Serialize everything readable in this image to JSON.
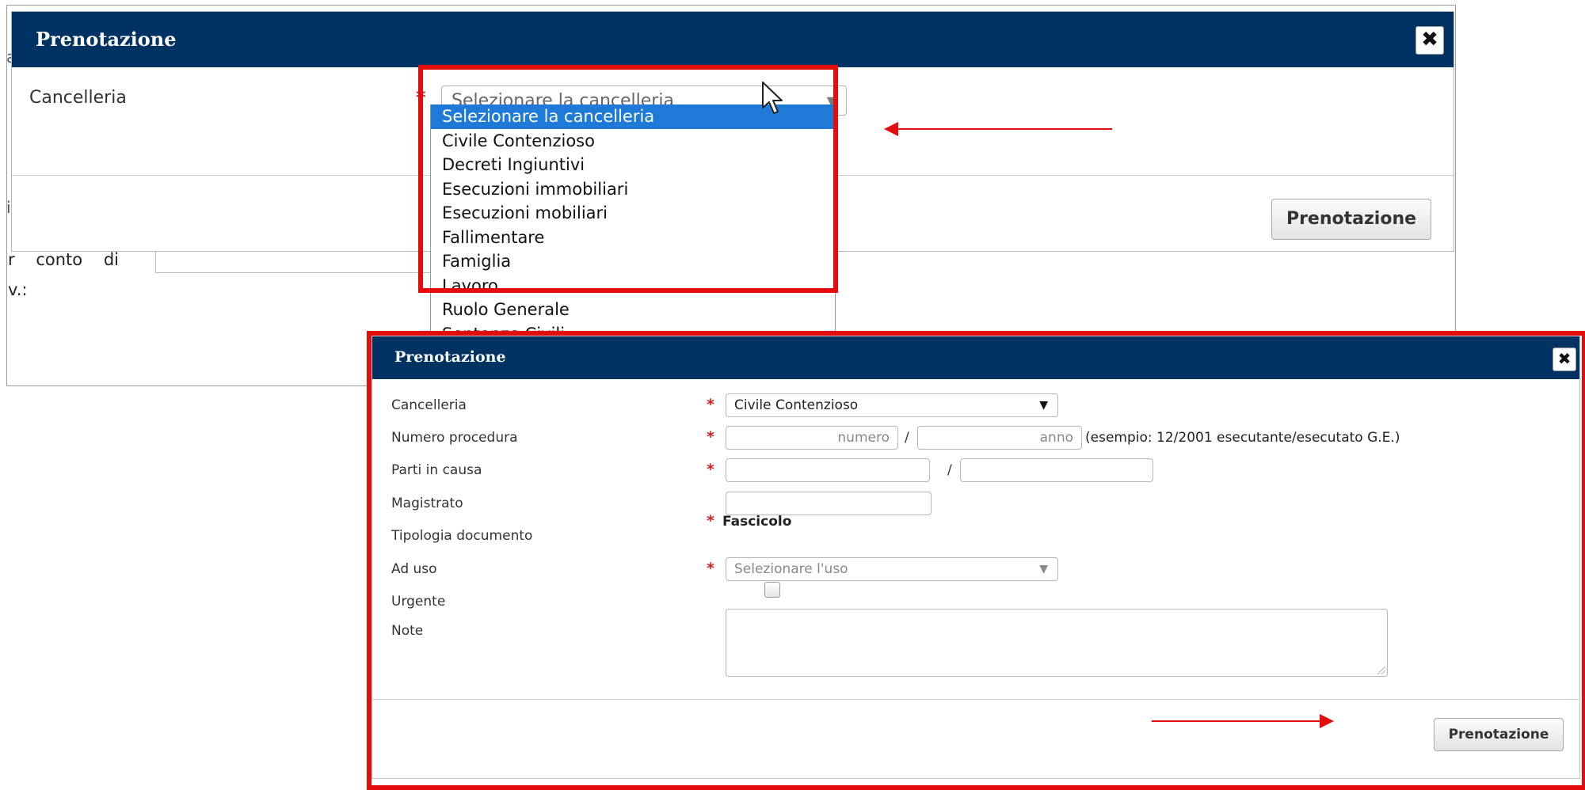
{
  "background": {
    "row_text": "r    conto    di",
    "row2_text": "v.:",
    "tick_a": "a",
    "tick_i": "i"
  },
  "dialog1": {
    "title": "Prenotazione",
    "close_glyph": "✖",
    "cancelleria_label": "Cancelleria",
    "required_mark": "*",
    "select_value": "Selezionare la cancelleria",
    "select_caret": "▼",
    "button_label": "Prenotazione",
    "dropdown_options": [
      "Selezionare la cancelleria",
      "Civile Contenzioso",
      "Decreti Ingiuntivi",
      "Esecuzioni immobiliari",
      "Esecuzioni mobiliari",
      "Fallimentare",
      "Famiglia",
      "Lavoro",
      "Ruolo Generale",
      "Sentenze Civili"
    ],
    "selected_option_index": 0
  },
  "dialog2": {
    "title": "Prenotazione",
    "close_glyph": "✖",
    "required_mark": "*",
    "fields": {
      "cancelleria_label": "Cancelleria",
      "cancelleria_value": "Civile Contenzioso",
      "select_caret": "▼",
      "numero_label": "Numero procedura",
      "numero_placeholder": "numero",
      "anno_placeholder": "anno",
      "numero_hint": "(esempio: 12/2001 esecutante/esecutato G.E.)",
      "parti_label": "Parti in causa",
      "magistrato_label": "Magistrato",
      "tipologia_label": "Tipologia documento",
      "tipologia_value": "Fascicolo",
      "uso_label": "Ad uso",
      "uso_value": "Selezionare l'uso",
      "urgente_label": "Urgente",
      "note_label": "Note",
      "slash": "/"
    },
    "button_label": "Prenotazione"
  },
  "colors": {
    "header_bg": "#003364",
    "highlight_red": "#e30d0d",
    "selected_option_bg": "#1e7ad6"
  }
}
